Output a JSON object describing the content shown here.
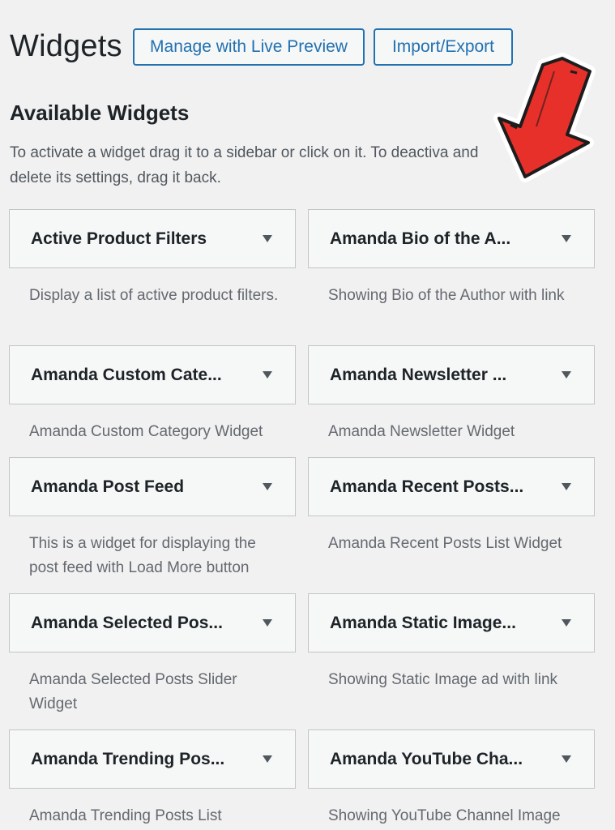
{
  "header": {
    "title": "Widgets",
    "live_preview_label": "Manage with Live Preview",
    "import_export_label": "Import/Export"
  },
  "available": {
    "title": "Available Widgets",
    "description": "To activate a widget drag it to a sidebar or click on it. To deactiva and delete its settings, drag it back."
  },
  "widgets": [
    {
      "title": "Active Product Filters",
      "desc": "Display a list of active product filters."
    },
    {
      "title": "Amanda Bio of the A...",
      "desc": "Showing Bio of the Author with link"
    },
    {
      "title": "Amanda Custom Cate...",
      "desc": "Amanda Custom Category Widget"
    },
    {
      "title": "Amanda Newsletter ...",
      "desc": "Amanda Newsletter Widget"
    },
    {
      "title": "Amanda Post Feed",
      "desc": "This is a widget for displaying the post feed with Load More button"
    },
    {
      "title": "Amanda Recent Posts...",
      "desc": "Amanda Recent Posts List Widget"
    },
    {
      "title": "Amanda Selected Pos...",
      "desc": "Amanda Selected Posts Slider Widget"
    },
    {
      "title": "Amanda Static Image...",
      "desc": "Showing Static Image ad with link"
    },
    {
      "title": "Amanda Trending Pos...",
      "desc": "Amanda Trending Posts List"
    },
    {
      "title": "Amanda YouTube Cha...",
      "desc": "Showing YouTube Channel Image"
    }
  ],
  "colors": {
    "accent": "#2271b1",
    "background": "#f1f1f1",
    "arrow": "#e8302a"
  },
  "icons": {
    "caret": "caret-down-icon",
    "annotation": "red-arrow-icon"
  }
}
